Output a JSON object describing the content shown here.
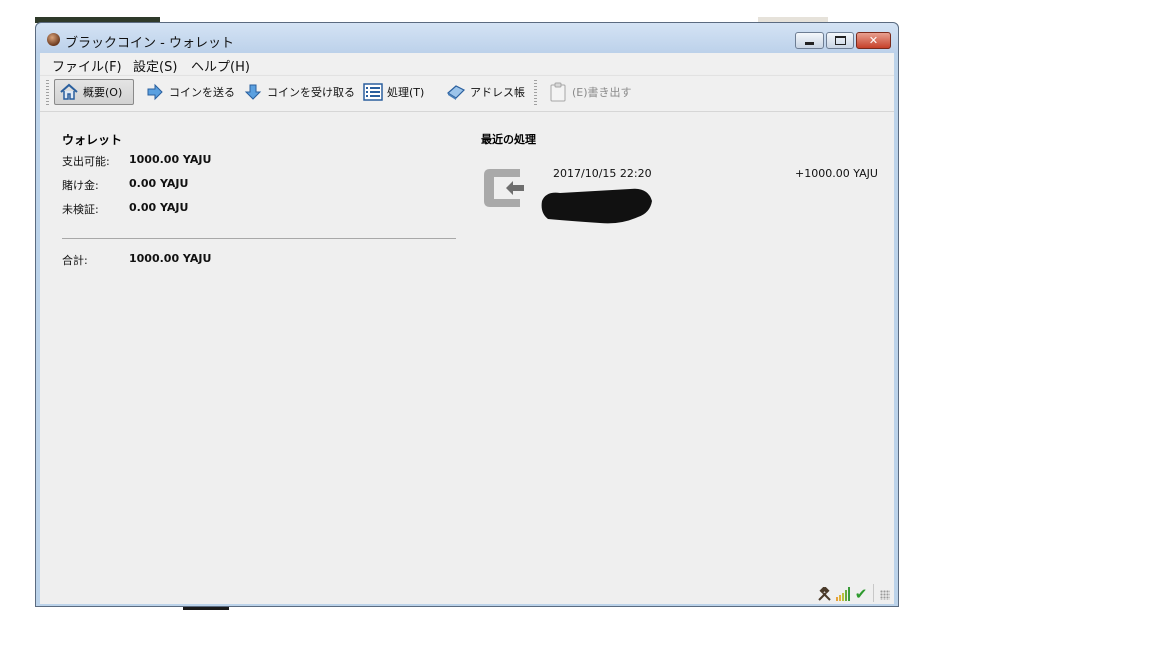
{
  "window": {
    "title": "ブラックコイン - ウォレット"
  },
  "menu": {
    "file": "ファイル(F)",
    "settings": "設定(S)",
    "help": "ヘルプ(H)"
  },
  "toolbar": {
    "overview": "概要(O)",
    "send": "コインを送る",
    "receive": "コインを受け取る",
    "transactions": "処理(T)",
    "address_book": "アドレス帳",
    "export": "(E)書き出す"
  },
  "wallet": {
    "title": "ウォレット",
    "spendable_label": "支出可能:",
    "spendable_value": "1000.00 YAJU",
    "stake_label": "賭け金:",
    "stake_value": "0.00 YAJU",
    "unconfirmed_label": "未検証:",
    "unconfirmed_value": "0.00 YAJU",
    "total_label": "合計:",
    "total_value": "1000.00 YAJU"
  },
  "recent": {
    "title": "最近の処理",
    "transactions": [
      {
        "date": "2017/10/15 22:20",
        "amount": "+1000.00 YAJU",
        "icon": "receive-arrow-icon"
      }
    ]
  },
  "status": {
    "icons": [
      "staking-hammer-icon",
      "connection-signal-icon",
      "sync-checkmark-icon"
    ],
    "colors": {
      "check": "#2e9a2e",
      "signal_high": "#3a9a3a",
      "signal_low": "#e6a23a"
    }
  }
}
